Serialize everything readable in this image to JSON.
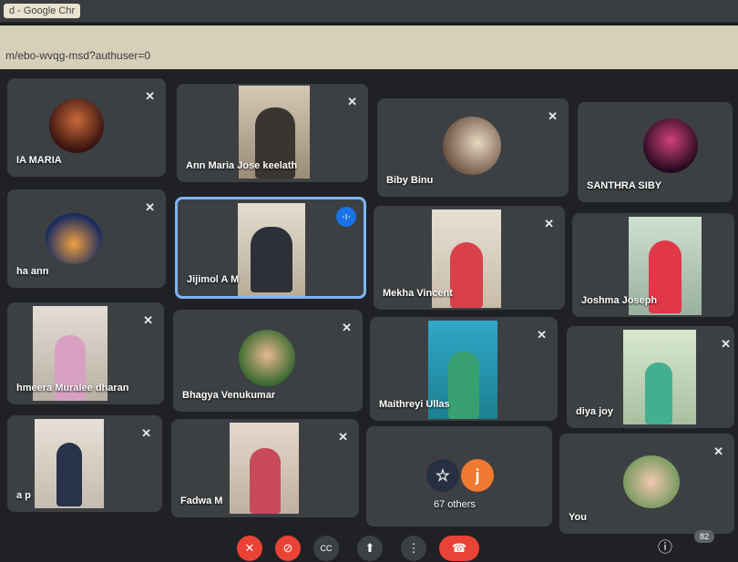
{
  "browser": {
    "tab_title": "d - Google Chr",
    "url": "m/ebo-wvqg-msd?authuser=0"
  },
  "mute_glyph": "✕",
  "speaking_glyph": "·ı·",
  "participants": [
    {
      "name": "IA MARIA",
      "muted": true
    },
    {
      "name": "Ann Maria Jose keelath",
      "muted": true
    },
    {
      "name": "Biby Binu",
      "muted": true
    },
    {
      "name": "SANTHRA SIBY",
      "muted": false
    },
    {
      "name": "ha ann",
      "muted": true
    },
    {
      "name": "Jijimol A M",
      "muted": false,
      "speaking": true
    },
    {
      "name": "Mekha Vincent",
      "muted": true
    },
    {
      "name": "Joshma Joseph",
      "muted": false
    },
    {
      "name": "hmeera Muralee dharan",
      "muted": true
    },
    {
      "name": "Bhagya Venukumar",
      "muted": true
    },
    {
      "name": "Maithreyi Ullas",
      "muted": true
    },
    {
      "name": "diya joy",
      "muted": true
    },
    {
      "name": "a p",
      "muted": true
    },
    {
      "name": "Fadwa M",
      "muted": true
    },
    {
      "name": "You",
      "muted": true
    }
  ],
  "others": {
    "label": "67 others",
    "avatar_letter": "j",
    "star_glyph": "☆"
  },
  "toolbar": {
    "mic_glyph": "✕",
    "camera_glyph": "⊘",
    "captions_glyph": "CC",
    "present_glyph": "⬆",
    "more_glyph": "⋮",
    "end_call_glyph": "☎",
    "info_glyph": "ⓘ",
    "people_count": "82"
  },
  "colors": {
    "accent": "#1a73e8",
    "end_call": "#ea4335",
    "tile": "#3c4043",
    "bg": "#202124"
  }
}
